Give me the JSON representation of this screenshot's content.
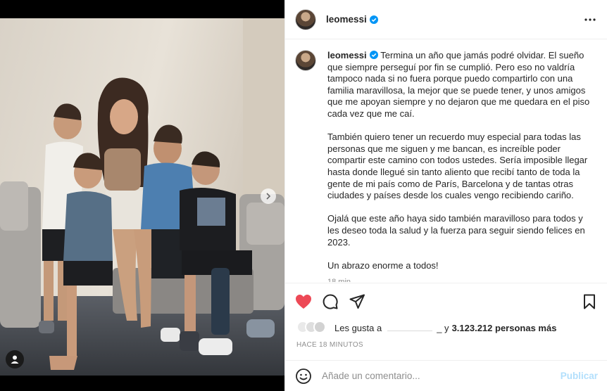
{
  "post": {
    "username": "leomessi",
    "verified": true,
    "caption_paragraphs": [
      "Termina un año que jamás podré olvidar. El sueño que siempre perseguí por fin se cumplió. Pero eso no valdría tampoco nada si no fuera porque puedo compartirlo con una familia maravillosa, la mejor que se puede tener, y unos amigos que me apoyan siempre y no dejaron que me quedara en el piso cada vez que me caí.",
      "También quiero tener un recuerdo muy especial para todas las personas que me siguen y me bancan, es increíble poder compartir este camino con todos ustedes. Sería imposible llegar hasta donde llegué sin tanto aliento que recibí tanto de toda la gente de mi país como de París, Barcelona y de tantas otras ciudades y países desde los cuales vengo recibiendo cariño.",
      "Ojalá que este año haya sido también maravilloso para todos y les deseo toda la salud y la fuerza para seguir siendo felices en 2023.",
      "Un abrazo enorme a todos!"
    ],
    "caption_timestamp_short": "18 min",
    "likes_prefix": "Les gusta a",
    "likes_suffix": "_ y",
    "likes_count_text": "3.123.212 personas más",
    "time_ago": "HACE 18 MINUTOS",
    "liked": true
  },
  "comment": {
    "placeholder": "Añade un comentario...",
    "publish_label": "Publicar"
  },
  "icons": {
    "like": "heart-icon",
    "comment": "comment-icon",
    "share": "send-icon",
    "save": "bookmark-icon",
    "more": "more-options-icon",
    "emoji": "emoji-icon",
    "next": "chevron-right-icon",
    "tag": "user-tag-icon"
  },
  "colors": {
    "like_red": "#ed4956",
    "verified_blue": "#0095f6",
    "publish_disabled": "#b2dffc",
    "secondary_text": "#8e8e8e"
  }
}
